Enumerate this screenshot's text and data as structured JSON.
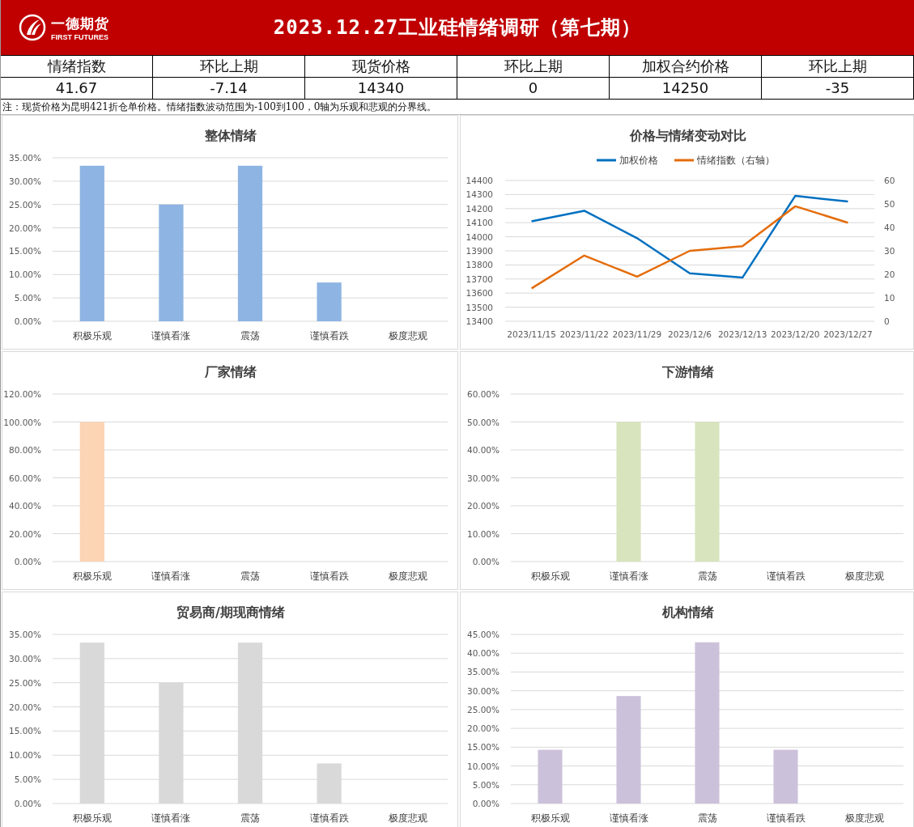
{
  "header": {
    "logo_name": "一德期货",
    "logo_sub": "FIRST FUTURES",
    "title": "2023.12.27工业硅情绪调研（第七期）"
  },
  "summary": [
    {
      "label": "情绪指数",
      "value": "41.67"
    },
    {
      "label": "环比上期",
      "value": "-7.14"
    },
    {
      "label": "现货价格",
      "value": "14340"
    },
    {
      "label": "环比上期",
      "value": "0"
    },
    {
      "label": "加权合约价格",
      "value": "14250"
    },
    {
      "label": "环比上期",
      "value": "-35"
    }
  ],
  "note": "注：现货价格为昆明421折仓单价格。情绪指数波动范围为-100到100，0轴为乐观和悲观的分界线。",
  "charts": [
    {
      "chart_data": {
        "type": "bar",
        "title": "整体情绪",
        "categories": [
          "积极乐观",
          "谨慎看涨",
          "震荡",
          "谨慎看跌",
          "极度悲观"
        ],
        "series": [
          {
            "color": "#8eb4e3",
            "values": [
              0.333,
              0.25,
              0.333,
              0.083,
              0
            ]
          }
        ],
        "ylim": [
          0,
          0.35
        ],
        "grid": true,
        "yticks": [
          {
            "value": 0,
            "label": "0.00%"
          },
          {
            "value": 0.05,
            "label": "5.00%"
          },
          {
            "value": 0.1,
            "label": "10.00%"
          },
          {
            "value": 0.15,
            "label": "15.00%"
          },
          {
            "value": 0.2,
            "label": "20.00%"
          },
          {
            "value": 0.25,
            "label": "25.00%"
          },
          {
            "value": 0.3,
            "label": "30.00%"
          },
          {
            "value": 0.35,
            "label": "35.00%"
          }
        ]
      }
    },
    {
      "chart_data": {
        "type": "line",
        "title": "价格与情绪变动对比",
        "categories": [
          "2023/11/15",
          "2023/11/22",
          "2023/11/29",
          "2023/12/6",
          "2023/12/13",
          "2023/12/20",
          "2023/12/27"
        ],
        "series": [
          {
            "name": "加权价格",
            "color": "#0070c0",
            "values": [
              14110,
              14185,
              13990,
              13740,
              13710,
              14290,
              14250
            ]
          },
          {
            "name": "情绪指数（右轴）",
            "color": "#e46c0a",
            "axis": "y2",
            "values": [
              14,
              28,
              19,
              30,
              32,
              49,
              42
            ]
          }
        ],
        "ylim": [
          13400,
          14400
        ],
        "grid": true,
        "yticks": [
          13400,
          13500,
          13600,
          13700,
          13800,
          13900,
          14000,
          14100,
          14200,
          14300,
          14400
        ],
        "legend": "top",
        "y2lim": [
          0,
          60
        ],
        "y2ticks": [
          0,
          10,
          20,
          30,
          40,
          50,
          60
        ]
      }
    },
    {
      "chart_data": {
        "type": "bar",
        "title": "厂家情绪",
        "categories": [
          "积极乐观",
          "谨慎看涨",
          "震荡",
          "谨慎看跌",
          "极度悲观"
        ],
        "series": [
          {
            "color": "#fcd5b5",
            "values": [
              1,
              0,
              0,
              0,
              0
            ]
          }
        ],
        "ylim": [
          0,
          1.2
        ],
        "grid": true,
        "yticks": [
          {
            "value": 0,
            "label": "0.00%"
          },
          {
            "value": 0.2,
            "label": "20.00%"
          },
          {
            "value": 0.4,
            "label": "40.00%"
          },
          {
            "value": 0.6,
            "label": "60.00%"
          },
          {
            "value": 0.8,
            "label": "80.00%"
          },
          {
            "value": 1,
            "label": "100.00%"
          },
          {
            "value": 1.2,
            "label": "120.00%"
          }
        ]
      }
    },
    {
      "chart_data": {
        "type": "bar",
        "title": "下游情绪",
        "categories": [
          "积极乐观",
          "谨慎看涨",
          "震荡",
          "谨慎看跌",
          "极度悲观"
        ],
        "series": [
          {
            "color": "#d7e4bd",
            "values": [
              0,
              0.5,
              0.5,
              0,
              0
            ]
          }
        ],
        "ylim": [
          0,
          0.6
        ],
        "grid": true,
        "yticks": [
          {
            "value": 0,
            "label": "0.00%"
          },
          {
            "value": 0.1,
            "label": "10.00%"
          },
          {
            "value": 0.2,
            "label": "20.00%"
          },
          {
            "value": 0.3,
            "label": "30.00%"
          },
          {
            "value": 0.4,
            "label": "40.00%"
          },
          {
            "value": 0.5,
            "label": "50.00%"
          },
          {
            "value": 0.6,
            "label": "60.00%"
          }
        ]
      }
    },
    {
      "chart_data": {
        "type": "bar",
        "title": "贸易商/期现商情绪",
        "categories": [
          "积极乐观",
          "谨慎看涨",
          "震荡",
          "谨慎看跌",
          "极度悲观"
        ],
        "series": [
          {
            "color": "#d9d9d9",
            "values": [
              0.333,
              0.25,
              0.333,
              0.083,
              0
            ]
          }
        ],
        "ylim": [
          0,
          0.35
        ],
        "grid": true,
        "yticks": [
          {
            "value": 0,
            "label": "0.00%"
          },
          {
            "value": 0.05,
            "label": "5.00%"
          },
          {
            "value": 0.1,
            "label": "10.00%"
          },
          {
            "value": 0.15,
            "label": "15.00%"
          },
          {
            "value": 0.2,
            "label": "20.00%"
          },
          {
            "value": 0.25,
            "label": "25.00%"
          },
          {
            "value": 0.3,
            "label": "30.00%"
          },
          {
            "value": 0.35,
            "label": "35.00%"
          }
        ]
      }
    },
    {
      "chart_data": {
        "type": "bar",
        "title": "机构情绪",
        "categories": [
          "积极乐观",
          "谨慎看涨",
          "震荡",
          "谨慎看跌",
          "极度悲观"
        ],
        "series": [
          {
            "color": "#ccc1da",
            "values": [
              0.143,
              0.286,
              0.429,
              0.143,
              0
            ]
          }
        ],
        "ylim": [
          0,
          0.45
        ],
        "grid": true,
        "yticks": [
          {
            "value": 0,
            "label": "0.00%"
          },
          {
            "value": 0.05,
            "label": "5.00%"
          },
          {
            "value": 0.1,
            "label": "10.00%"
          },
          {
            "value": 0.15,
            "label": "15.00%"
          },
          {
            "value": 0.2,
            "label": "20.00%"
          },
          {
            "value": 0.25,
            "label": "25.00%"
          },
          {
            "value": 0.3,
            "label": "30.00%"
          },
          {
            "value": 0.35,
            "label": "35.00%"
          },
          {
            "value": 0.4,
            "label": "40.00%"
          },
          {
            "value": 0.45,
            "label": "45.00%"
          }
        ]
      }
    }
  ]
}
